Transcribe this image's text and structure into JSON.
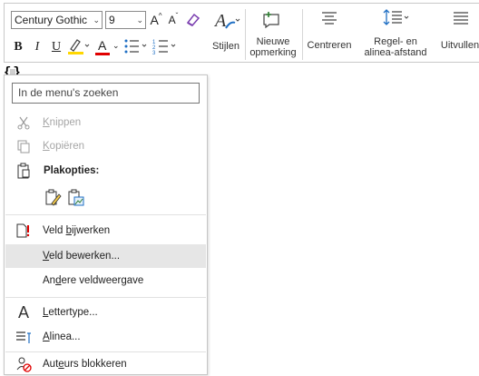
{
  "toolbar": {
    "font_name": "Century Gothic",
    "font_size": "9",
    "grow_font": "A",
    "shrink_font": "A",
    "bold": "B",
    "italic": "I",
    "underline": "U",
    "font_color_letter": "A",
    "styles_label": "Stijlen",
    "new_comment_label_1": "Nieuwe",
    "new_comment_label_2": "opmerking",
    "center_label": "Centreren",
    "spacing_label_1": "Regel- en",
    "spacing_label_2": "alinea-afstand",
    "justify_label": "Uitvullen",
    "colors": {
      "highlight": "#ffd700",
      "font_color": "#e00000",
      "accent_icon": "#2e7d32"
    }
  },
  "field": {
    "open": "{",
    "close": "}"
  },
  "menu": {
    "search_placeholder": "In de menu's zoeken",
    "cut": {
      "pre": "",
      "key": "K",
      "post": "nippen"
    },
    "copy": {
      "pre": "",
      "key": "K",
      "post": "opiëren"
    },
    "paste_options": "Plakopties:",
    "update_field": {
      "pre": "Veld ",
      "key": "b",
      "post": "ijwerken"
    },
    "edit_field": {
      "pre": "",
      "key": "V",
      "post": "eld bewerken..."
    },
    "toggle_field": {
      "pre": "An",
      "key": "d",
      "post": "ere veldweergave"
    },
    "font": {
      "pre": "",
      "key": "L",
      "post": "ettertype..."
    },
    "paragraph": {
      "pre": "",
      "key": "A",
      "post": "linea..."
    },
    "block_authors": {
      "pre": "Aut",
      "key": "e",
      "post": "urs blokkeren"
    }
  }
}
